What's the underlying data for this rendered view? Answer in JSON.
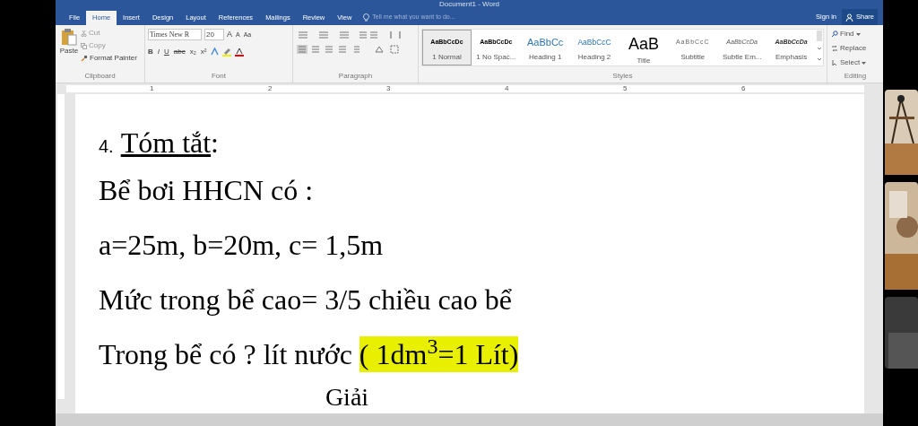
{
  "window": {
    "title": "Document1 - Word"
  },
  "tabs": [
    {
      "label": "File",
      "selected": false
    },
    {
      "label": "Home",
      "selected": true
    },
    {
      "label": "Insert",
      "selected": false
    },
    {
      "label": "Design",
      "selected": false
    },
    {
      "label": "Layout",
      "selected": false
    },
    {
      "label": "References",
      "selected": false
    },
    {
      "label": "Mailings",
      "selected": false
    },
    {
      "label": "Review",
      "selected": false
    },
    {
      "label": "View",
      "selected": false
    }
  ],
  "tell_me": {
    "placeholder": "Tell me what you want to do..."
  },
  "account": {
    "sign_in": "Sign in",
    "share": "Share"
  },
  "clipboard": {
    "paste": "Paste",
    "cut": "Cut",
    "copy": "Copy",
    "format_painter": "Format Painter",
    "label": "Clipboard"
  },
  "font": {
    "name": "Times New R",
    "size": "20",
    "label": "Font",
    "row1": [
      "A",
      "A",
      "Aa"
    ],
    "row2": [
      "B",
      "I",
      "U",
      "abc",
      "x₂",
      "x²"
    ]
  },
  "paragraph": {
    "label": "Paragraph"
  },
  "styles": {
    "label": "Styles",
    "items": [
      {
        "kind": "normal",
        "preview": "AaBbCcDc",
        "name": "1 Normal",
        "selected": true
      },
      {
        "kind": "normal",
        "preview": "AaBbCcDc",
        "name": "1 No Spac...",
        "selected": false
      },
      {
        "kind": "heading1",
        "preview": "AaBbCc",
        "name": "Heading 1",
        "selected": false
      },
      {
        "kind": "heading2",
        "preview": "AaBbCcC",
        "name": "Heading 2",
        "selected": false
      },
      {
        "kind": "title",
        "preview": "AaB",
        "name": "Title",
        "selected": false
      },
      {
        "kind": "subtitle",
        "preview": "AaBbCcC",
        "name": "Subtitle",
        "selected": false
      },
      {
        "kind": "italic",
        "preview": "AaBbCcDa",
        "name": "Subtle Em...",
        "selected": false
      },
      {
        "kind": "bolditalic",
        "preview": "AaBbCcDa",
        "name": "Emphasis",
        "selected": false
      }
    ]
  },
  "editing": {
    "find": "Find",
    "replace": "Replace",
    "select": "Select",
    "label": "Editing"
  },
  "ruler": [
    "1",
    "2",
    "3",
    "4",
    "5",
    "6"
  ],
  "document": {
    "heading": {
      "number": "4.",
      "title": "Tóm tắt",
      "suffix": ":"
    },
    "lines": [
      {
        "text": "Bể bơi HHCN có :"
      },
      {
        "text": "a=25m, b=20m, c= 1,5m"
      },
      {
        "text": "Mức trong bể cao= 3/5 chiều cao bể"
      },
      {
        "text": "Trong bể có ? lít nước",
        "highlight": "( 1dm$^{3}$=1 Lít)"
      },
      {
        "text": "Giải"
      }
    ]
  }
}
